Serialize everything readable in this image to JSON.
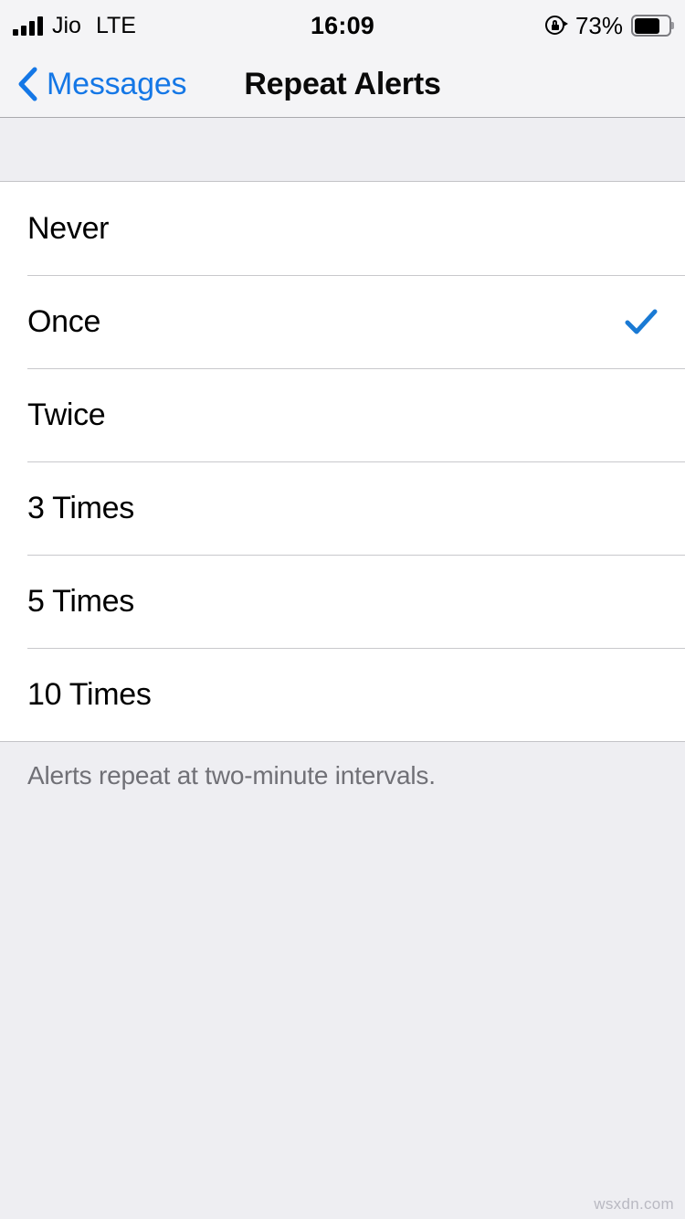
{
  "status_bar": {
    "carrier": "Jio",
    "network_type": "LTE",
    "time": "16:09",
    "battery_percent": "73%",
    "battery_level": 73,
    "signal_bars": 4,
    "rotation_lock_icon": "rotation-lock-icon",
    "battery_icon": "battery-icon",
    "signal_icon": "cellular-signal-icon"
  },
  "nav_bar": {
    "back_label": "Messages",
    "back_icon": "chevron-left-icon",
    "title": "Repeat Alerts"
  },
  "list": {
    "items": [
      {
        "label": "Never",
        "selected": false
      },
      {
        "label": "Once",
        "selected": true
      },
      {
        "label": "Twice",
        "selected": false
      },
      {
        "label": "3 Times",
        "selected": false
      },
      {
        "label": "5 Times",
        "selected": false
      },
      {
        "label": "10 Times",
        "selected": false
      }
    ],
    "check_icon": "checkmark-icon"
  },
  "footer": {
    "note": "Alerts repeat at two-minute intervals."
  },
  "watermark": {
    "text": "wsxdn.com"
  },
  "colors": {
    "accent_blue": "#1477e6",
    "check_blue": "#1a7ad4",
    "page_background": "#eeeef2",
    "bar_background": "#f4f4f6",
    "row_background": "#ffffff",
    "separator": "#c8c8cc",
    "footer_text": "#707076"
  }
}
